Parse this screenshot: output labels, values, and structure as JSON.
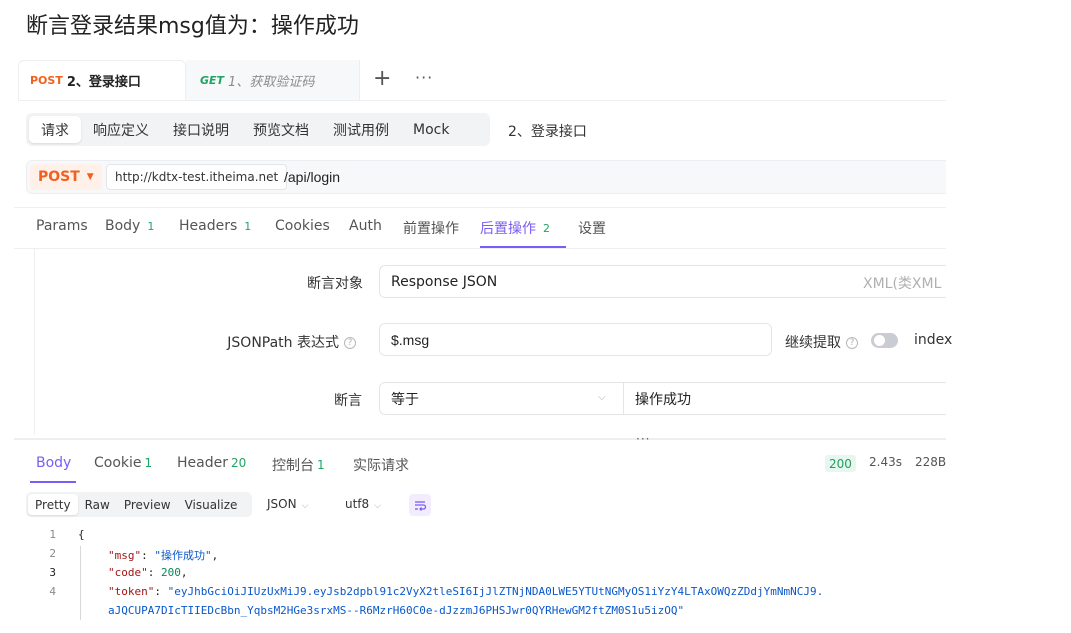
{
  "page_title": "断言登录结果msg值为：操作成功",
  "doc_tabs": [
    {
      "method": "POST",
      "name": "2、登录接口",
      "active": true
    },
    {
      "method": "GET",
      "name": "1、获取验证码",
      "active": false
    }
  ],
  "tab_add": "+",
  "tab_more": "···",
  "segment_tabs": [
    "请求",
    "响应定义",
    "接口说明",
    "预览文档",
    "测试用例",
    "Mock"
  ],
  "api_name": "2、登录接口",
  "request": {
    "method": "POST",
    "base_url": "http://kdtx-test.itheima.net",
    "path": "/api/login"
  },
  "req_tabs": {
    "params": "Params",
    "body": "Body",
    "body_count": "1",
    "headers": "Headers",
    "headers_count": "1",
    "cookies": "Cookies",
    "auth": "Auth",
    "pre": "前置操作",
    "post": "后置操作",
    "post_count": "2",
    "settings": "设置"
  },
  "assertion": {
    "target_label": "断言对象",
    "target_value": "Response JSON",
    "target_right": "XML(类XML",
    "jsonpath_label": "JSONPath 表达式",
    "jsonpath_value": "$.msg",
    "continue_label": "继续提取",
    "index_label": "index",
    "assert_label": "断言",
    "operator": "等于",
    "expected": "操作成功"
  },
  "split_handle": "···",
  "resp_tabs": {
    "body": "Body",
    "cookie": "Cookie",
    "cookie_count": "1",
    "header": "Header",
    "header_count": "20",
    "console": "控制台",
    "console_count": "1",
    "actual": "实际请求"
  },
  "response_meta": {
    "status": "200",
    "time": "2.43s",
    "size": "228B"
  },
  "view_modes": [
    "Pretty",
    "Raw",
    "Preview",
    "Visualize"
  ],
  "format": "JSON",
  "encoding": "utf8",
  "code_lines": {
    "l1": "{",
    "l2_key": "\"msg\"",
    "l2_val": "\"操作成功\"",
    "l3_key": "\"code\"",
    "l3_val": "200",
    "l4_key": "\"token\"",
    "l4_val": "\"eyJhbGciOiJIUzUxMiJ9.eyJsb2dpbl91c2VyX2tleSI6IjJlZTNjNDA0LWE5YTUtNGMyOS1iYzY4LTAxOWQzZDdjYmNmNCJ9.",
    "l4_cont": "aJQCUPA7DIcTIIEDcBbn_YqbsM2HGe3srxMS--R6MzrH60C0e-dJzzmJ6PHSJwr0QYRHewGM2ftZM0S1u5izOQ\"",
    "nums": [
      "1",
      "2",
      "3",
      "4"
    ]
  }
}
